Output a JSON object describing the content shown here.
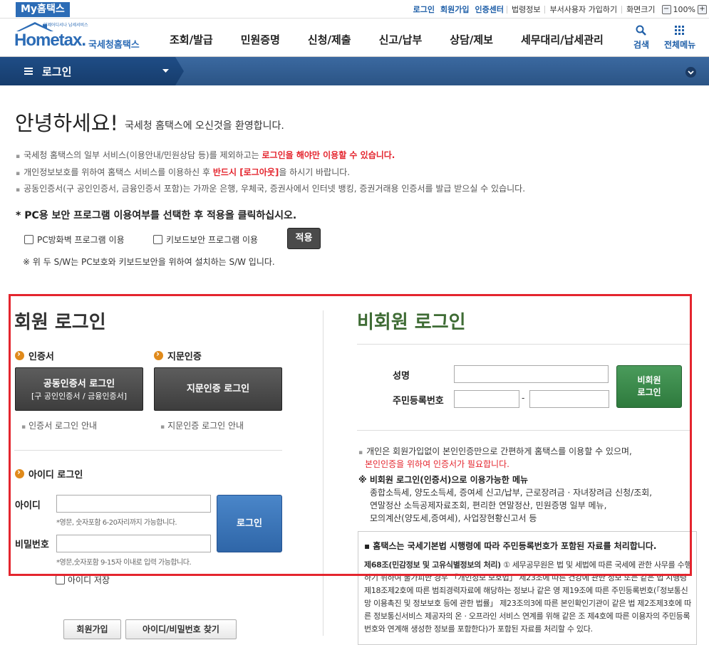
{
  "topbar": {
    "tab": "My홈택스",
    "links_bold": [
      "로그인",
      "회원가입",
      "인증센터"
    ],
    "links": [
      "법령정보",
      "부서사용자 가입하기",
      "화면크기"
    ],
    "zoom_minus": "−",
    "zoom": "100%",
    "zoom_plus": "+"
  },
  "header": {
    "logo_small": "언제어디서나 납세서비스",
    "logo_main": "Hometax.",
    "logo_kor": "국세청홈택스",
    "nav": [
      "조회/발급",
      "민원증명",
      "신청/제출",
      "신고/납부",
      "상담/제보",
      "세무대리/납세관리"
    ],
    "search_label": "검색",
    "allmenu_label": "전체메뉴"
  },
  "navbar": {
    "label": "로그인"
  },
  "intro": {
    "greeting": "안녕하세요!",
    "welcome": "국세청 홈택스에 오신것을 환영합니다.",
    "bullet1_a": "국세청 홈택스의 일부 서비스(이용안내/민원상담 등)를 제외하고는 ",
    "bullet1_b": "로그인을 해야만 이용할 수 있습니다.",
    "bullet2_a": "개인정보보호를 위하여 홈택스 서비스를 이용하신 후 ",
    "bullet2_b": "반드시 [로그아웃]",
    "bullet2_c": "을 하시기 바랍니다.",
    "bullet3": "공동인증서(구 공인인증서, 금융인증서 포함)는 가까운 은행, 우체국, 증권사에서 인터넷 뱅킹, 증권거래용 인증서를 발급 받으실 수 있습니다.",
    "pc_question": "* PC용 보안 프로그램 이용여부를 선택한 후 적용을 클릭하십시오.",
    "firewall_label": "PC방화벽 프로그램 이용",
    "keyboard_label": "키보드보안 프로그램 이용",
    "apply": "적용",
    "sw_note": "※ 위 두 S/W는 PC보호와 키보드보안을 위하여 설치하는 S/W 입니다."
  },
  "member": {
    "title": "회원 로그인",
    "cert_section": "인증서",
    "bio_section": "지문인증",
    "cert_btn_line1": "공동인증서 로그인",
    "cert_btn_line2": "[구 공인인증서 / 금융인증서]",
    "bio_btn": "지문인증 로그인",
    "cert_guide": "인증서 로그인 안내",
    "bio_guide": "지문인증 로그인 안내",
    "id_section": "아이디 로그인",
    "id_label": "아이디",
    "id_hint": "*영문, 숫자포함 6-20자리까지 가능합니다.",
    "pw_label": "비밀번호",
    "pw_hint": "*영문,숫자포함 9-15자 이내로 입력 가능합니다.",
    "login_btn": "로그인",
    "save_id": "아이디 저장",
    "join_btn": "회원가입",
    "find_btn": "아이디/비밀번호 찾기"
  },
  "nonmember": {
    "title": "비회원 로그인",
    "name_label": "성명",
    "rrn_label": "주민등록번호",
    "dash": "-",
    "btn_line1": "비회원",
    "btn_line2": "로그인",
    "note1": "개인은 회원가입없이 본인인증만으로 간편하게 홈택스를 이용할 수 있으며,",
    "note2": "본인인증을 위하여 인증서가 필요합니다.",
    "menu_head": "※ 비회원 로그인(인증서)으로 이용가능한 메뉴",
    "menu1": "종합소득세, 양도소득세, 증여세 신고/납부, 근로장려금 · 자녀장려금 신청/조회,",
    "menu2": "연말정산 소득공제자료조회, 편리한 연말정산, 민원증명 일부 메뉴,",
    "menu3": "모의계산(양도세,증여세), 사업장현황신고서 등",
    "law_head": "▪ 홈택스는 국세기본법 시행령에 따라 주민등록번호가 포함된 자료를 처리합니다.",
    "law_title": "제68조(민감정보 및 고유식별정보의 처리)",
    "law_text": " ① 세무공무원은 법 및 세법에 따른 국세에 관한 사무를 수행하기 위하여 불가피한 경우 「개인정보 보호법」 제23조에 따른 건강에 관한 정보 또는 같은 법 시행령 제18조제2호에 따른 범죄경력자료에 해당하는 정보나 같은 영 제19조에 따른 주민등록번호(「정보통신망 이용촉진 및 정보보호 등에 관한 법률」 제23조의3에 따른 본인확인기관이 같은 법 제2조제3호에 따른 정보통신서비스 제공자의 온 · 오프라인 서비스 연계를 위해 같은 조 제4호에 따른 이용자의 주민등록번호와 연계해 생성한 정보를 포함한다)가 포함된 자료를 처리할 수 있다."
  },
  "colors": {
    "primary_blue": "#2c6cb6",
    "alert_red": "#e4252e",
    "nonmember_green": "#3f6c35",
    "section_orange": "#e08a1b"
  }
}
